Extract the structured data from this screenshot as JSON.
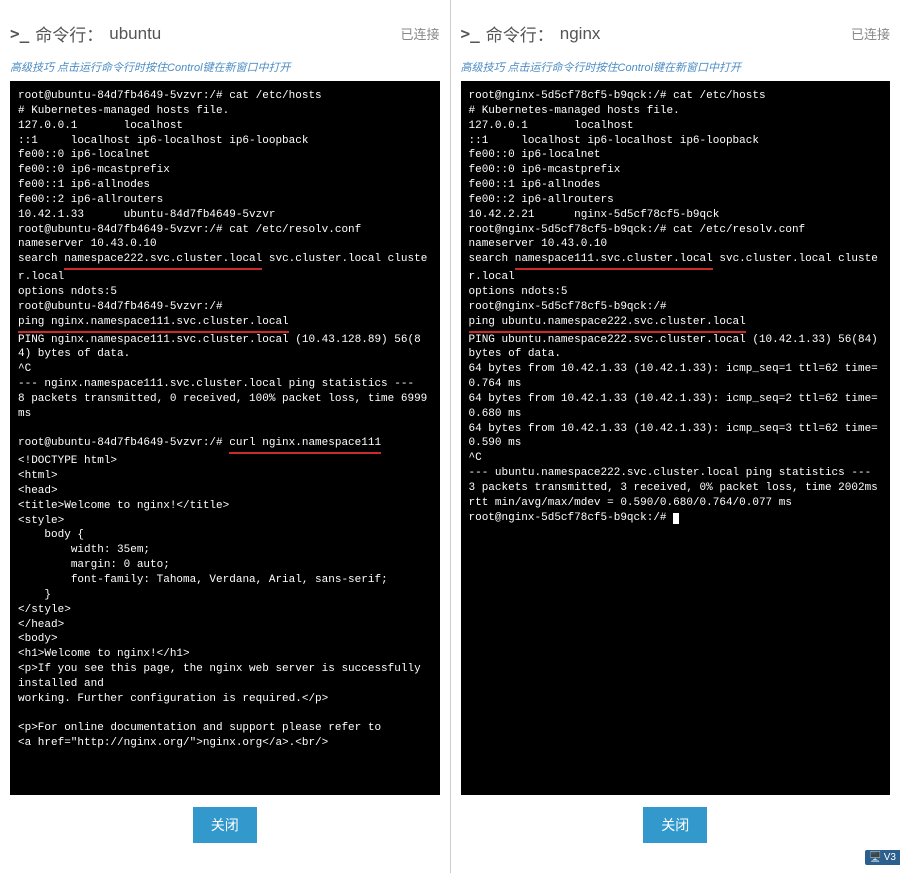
{
  "left": {
    "title_prefix": "命令行：",
    "title_name": "ubuntu",
    "status": "已连接",
    "tip_label": "高级技巧",
    "tip_text": " 点击运行命令行时按住Control键在新窗口中打开",
    "close_label": "关闭",
    "terminal": {
      "l01": "root@ubuntu-84d7fb4649-5vzvr:/# cat /etc/hosts",
      "l02": "# Kubernetes-managed hosts file.",
      "l03": "127.0.0.1       localhost",
      "l04": "::1     localhost ip6-localhost ip6-loopback",
      "l05": "fe00::0 ip6-localnet",
      "l06": "fe00::0 ip6-mcastprefix",
      "l07": "fe00::1 ip6-allnodes",
      "l08": "fe00::2 ip6-allrouters",
      "l09": "10.42.1.33      ubuntu-84d7fb4649-5vzvr",
      "l10": "root@ubuntu-84d7fb4649-5vzvr:/# cat /etc/resolv.conf",
      "l11": "nameserver 10.43.0.10",
      "l12a": "search ",
      "l12b": "namespace222.svc.cluster.local",
      "l12c": " svc.cluster.local cluster.local",
      "l13": "options ndots:5",
      "l14a": "root@ubuntu-84d7fb4649-5vzvr:/# ",
      "l14b": "ping nginx.namespace111.svc.cluster.local",
      "l15": "PING nginx.namespace111.svc.cluster.local (10.43.128.89) 56(84) bytes of data.",
      "l16": "^C",
      "l17": "--- nginx.namespace111.svc.cluster.local ping statistics ---",
      "l18": "8 packets transmitted, 0 received, 100% packet loss, time 6999ms",
      "l19": " ",
      "l20a": "root@ubuntu-84d7fb4649-5vzvr:/# ",
      "l20b": "curl nginx.namespace111",
      "l21": "<!DOCTYPE html>",
      "l22": "<html>",
      "l23": "<head>",
      "l24": "<title>Welcome to nginx!</title>",
      "l25": "<style>",
      "l26": "    body {",
      "l27": "        width: 35em;",
      "l28": "        margin: 0 auto;",
      "l29": "        font-family: Tahoma, Verdana, Arial, sans-serif;",
      "l30": "    }",
      "l31": "</style>",
      "l32": "</head>",
      "l33": "<body>",
      "l34": "<h1>Welcome to nginx!</h1>",
      "l35": "<p>If you see this page, the nginx web server is successfully installed and",
      "l36": "working. Further configuration is required.</p>",
      "l37": " ",
      "l38": "<p>For online documentation and support please refer to",
      "l39": "<a href=\"http://nginx.org/\">nginx.org</a>.<br/>"
    }
  },
  "right": {
    "title_prefix": "命令行：",
    "title_name": "nginx",
    "status": "已连接",
    "tip_label": "高级技巧",
    "tip_text": " 点击运行命令行时按住Control键在新窗口中打开",
    "close_label": "关闭",
    "terminal": {
      "l01": "root@nginx-5d5cf78cf5-b9qck:/# cat /etc/hosts",
      "l02": "# Kubernetes-managed hosts file.",
      "l03": "127.0.0.1       localhost",
      "l04": "::1     localhost ip6-localhost ip6-loopback",
      "l05": "fe00::0 ip6-localnet",
      "l06": "fe00::0 ip6-mcastprefix",
      "l07": "fe00::1 ip6-allnodes",
      "l08": "fe00::2 ip6-allrouters",
      "l09": "10.42.2.21      nginx-5d5cf78cf5-b9qck",
      "l10": "root@nginx-5d5cf78cf5-b9qck:/# cat /etc/resolv.conf",
      "l11": "nameserver 10.43.0.10",
      "l12a": "search ",
      "l12b": "namespace111.svc.cluster.local",
      "l12c": " svc.cluster.local cluster.local",
      "l13": "options ndots:5",
      "l14a": "root@nginx-5d5cf78cf5-b9qck:/# ",
      "l14b": "ping ubuntu.namespace222.svc.cluster.local",
      "l15": "PING ubuntu.namespace222.svc.cluster.local (10.42.1.33) 56(84) bytes of data.",
      "l16": "64 bytes from 10.42.1.33 (10.42.1.33): icmp_seq=1 ttl=62 time=0.764 ms",
      "l17": "64 bytes from 10.42.1.33 (10.42.1.33): icmp_seq=2 ttl=62 time=0.680 ms",
      "l18": "64 bytes from 10.42.1.33 (10.42.1.33): icmp_seq=3 ttl=62 time=0.590 ms",
      "l19": "^C",
      "l20": "--- ubuntu.namespace222.svc.cluster.local ping statistics ---",
      "l21": "3 packets transmitted, 3 received, 0% packet loss, time 2002ms",
      "l22": "rtt min/avg/max/mdev = 0.590/0.680/0.764/0.077 ms",
      "l23": "root@nginx-5d5cf78cf5-b9qck:/# "
    },
    "taskbar": "V3"
  }
}
